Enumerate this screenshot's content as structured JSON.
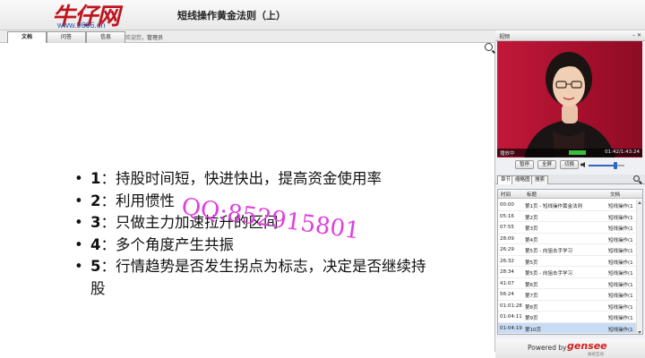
{
  "header": {
    "logo_text": "牛仔网",
    "logo_url": "www.9666.cn",
    "title": "短线操作黄金法则（上）"
  },
  "tabs": [
    {
      "label": "文档",
      "active": true
    },
    {
      "label": "问答",
      "active": false
    },
    {
      "label": "信息",
      "active": false
    }
  ],
  "welcome": {
    "prefix": "欢迎您，",
    "user": "管理员"
  },
  "slide": {
    "bullets": [
      {
        "num": "1",
        "sep": "：",
        "text": "持股时间短，快进快出，提高资金使用率"
      },
      {
        "num": "2",
        "sep": "：",
        "text": "利用惯性"
      },
      {
        "num": "3",
        "sep": "：",
        "text": "只做主力加速拉升的区间"
      },
      {
        "num": "4",
        "sep": "：",
        "text": "多个角度产生共振"
      },
      {
        "num": "5",
        "sep": "：",
        "text": "行情趋势是否发生拐点为标志，决定是否继续持股"
      }
    ],
    "watermark": "QQ:852915801"
  },
  "video": {
    "panel_label": "视频",
    "status": "播放中",
    "progress": 0.52,
    "time": "01:42/1:43:24",
    "buttons": {
      "pause": "暂停",
      "fullscreen": "全屏",
      "switch": "切换"
    },
    "volume": 0.75
  },
  "subtabs": [
    {
      "label": "章节",
      "active": true
    },
    {
      "label": "缩略图",
      "active": false
    },
    {
      "label": "搜索",
      "active": false
    }
  ],
  "chapters": {
    "columns": [
      "时间",
      "标题",
      "文档"
    ],
    "rows": [
      {
        "time": "00:00",
        "title": "第1页 - 短线操作黄金法则",
        "doc": "短线操作(1",
        "selected": false
      },
      {
        "time": "05:16",
        "title": "第2页",
        "doc": "短线操作(1",
        "selected": false
      },
      {
        "time": "07:55",
        "title": "第3页",
        "doc": "短线操作(1",
        "selected": false
      },
      {
        "time": "28:09",
        "title": "第4页",
        "doc": "短线操作(1",
        "selected": false
      },
      {
        "time": "26:29",
        "title": "第5页 - 向狙击手学习",
        "doc": "短线操作(1",
        "selected": false
      },
      {
        "time": "26:32",
        "title": "第5页",
        "doc": "短线操作(1",
        "selected": false
      },
      {
        "time": "28:34",
        "title": "第5页 - 向狙击手学习",
        "doc": "短线操作(1",
        "selected": false
      },
      {
        "time": "41:07",
        "title": "第6页",
        "doc": "短线操作(1",
        "selected": false
      },
      {
        "time": "56:24",
        "title": "第7页",
        "doc": "短线操作(1",
        "selected": false
      },
      {
        "time": "01:01:28",
        "title": "第8页",
        "doc": "短线操作(1",
        "selected": false
      },
      {
        "time": "01:04:11",
        "title": "第9页",
        "doc": "短线操作(1",
        "selected": false
      },
      {
        "time": "01:04:19",
        "title": "第10页",
        "doc": "短线操作(1",
        "selected": true
      }
    ]
  },
  "footer": {
    "powered_by": "Powered by",
    "brand": "gensee",
    "brand_sub": "展视互动"
  },
  "colors": {
    "brand_red": "#c0141e",
    "watermark": "#e03ee0",
    "selected_row": "#c9dcf5",
    "progress": "#3bbf3b"
  }
}
